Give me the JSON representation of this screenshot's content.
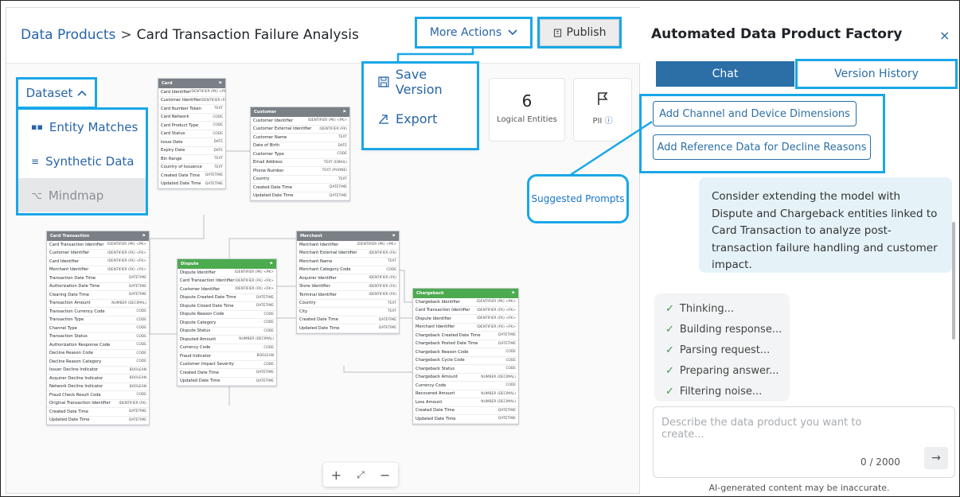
{
  "breadcrumb": {
    "parent": "Data Products",
    "separator": ">",
    "current": "Card Transaction Failure Analysis"
  },
  "toolbar": {
    "more_actions": "More Actions",
    "publish": "Publish"
  },
  "actions_menu": [
    {
      "label": "Save Version",
      "icon": "save-icon"
    },
    {
      "label": "Export",
      "icon": "export-icon"
    }
  ],
  "dataset": {
    "label": "Dataset",
    "items": [
      {
        "label": "Entity Matches",
        "icon": "grid-icon",
        "enabled": true
      },
      {
        "label": "Synthetic Data",
        "icon": "list-icon",
        "enabled": true
      },
      {
        "label": "Mindmap",
        "icon": "mindmap-icon",
        "enabled": false
      }
    ]
  },
  "stats": {
    "entities_count": "6",
    "entities_label": "Logical Entities",
    "pii_label": "PII"
  },
  "entities": {
    "card": {
      "name": "Card",
      "rows": [
        [
          "Card Identifier",
          "IDENTIFIER (PK) <PK>"
        ],
        [
          "Customer Identifier",
          "IDENTIFIER (FK) <FK>"
        ],
        [
          "Card Number Token",
          "TEXT"
        ],
        [
          "Card Network",
          "CODE"
        ],
        [
          "Card Product Type",
          "CODE"
        ],
        [
          "Card Status",
          "CODE"
        ],
        [
          "Issue Date",
          "DATE"
        ],
        [
          "Expiry Date",
          "DATE"
        ],
        [
          "Bin Range",
          "TEXT"
        ],
        [
          "Country of Issuance",
          "TEXT"
        ],
        [
          "Created Date Time",
          "DATETIME"
        ],
        [
          "Updated Date Time",
          "DATETIME"
        ]
      ]
    },
    "customer": {
      "name": "Customer",
      "rows": [
        [
          "Customer Identifier",
          "IDENTIFIER (PK) <PK>"
        ],
        [
          "Customer External Identifier",
          "IDENTIFIER (FK)"
        ],
        [
          "Customer Name",
          "TEXT"
        ],
        [
          "Date of Birth",
          "DATE"
        ],
        [
          "Customer Type",
          "CODE"
        ],
        [
          "Email Address",
          "TEXT (EMAIL)"
        ],
        [
          "Phone Number",
          "TEXT (PHONE)"
        ],
        [
          "Country",
          "TEXT"
        ],
        [
          "Created Date Time",
          "DATETIME"
        ],
        [
          "Updated Date Time",
          "DATETIME"
        ]
      ]
    },
    "card_transaction": {
      "name": "Card Transaction",
      "rows": [
        [
          "Card Transaction Identifier",
          "IDENTIFIER (PK) <PK>"
        ],
        [
          "Customer Identifier",
          "IDENTIFIER (FK) <FK>"
        ],
        [
          "Card Identifier",
          "IDENTIFIER (FK) <FK>"
        ],
        [
          "Merchant Identifier",
          "IDENTIFIER (FK) <FK>"
        ],
        [
          "Transaction Date Time",
          "DATETIME"
        ],
        [
          "Authorization Date Time",
          "DATETIME"
        ],
        [
          "Clearing Date Time",
          "DATETIME"
        ],
        [
          "Transaction Amount",
          "NUMBER (DECIMAL)"
        ],
        [
          "Transaction Currency Code",
          "CODE"
        ],
        [
          "Transaction Type",
          "CODE"
        ],
        [
          "Channel Type",
          "CODE"
        ],
        [
          "Transaction Status",
          "CODE"
        ],
        [
          "Authorization Response Code",
          "CODE"
        ],
        [
          "Decline Reason Code",
          "CODE"
        ],
        [
          "Decline Reason Category",
          "CODE"
        ],
        [
          "Issuer Decline Indicator",
          "BOOLEAN"
        ],
        [
          "Acquirer Decline Indicator",
          "BOOLEAN"
        ],
        [
          "Network Decline Indicator",
          "BOOLEAN"
        ],
        [
          "Fraud Check Result Code",
          "CODE"
        ],
        [
          "Original Transaction Identifier",
          "IDENTIFIER (FK)"
        ],
        [
          "Created Date Time",
          "DATETIME"
        ],
        [
          "Updated Date Time",
          "DATETIME"
        ]
      ]
    },
    "dispute": {
      "name": "Dispute",
      "rows": [
        [
          "Dispute Identifier",
          "IDENTIFIER (PK) <PK>"
        ],
        [
          "Card Transaction Identifier",
          "IDENTIFIER (FK) <FK>"
        ],
        [
          "Customer Identifier",
          "IDENTIFIER (FK) <FK>"
        ],
        [
          "Dispute Created Date Time",
          "DATETIME"
        ],
        [
          "Dispute Closed Date Time",
          "DATETIME"
        ],
        [
          "Dispute Reason Code",
          "CODE"
        ],
        [
          "Dispute Category",
          "CODE"
        ],
        [
          "Dispute Status",
          "CODE"
        ],
        [
          "Disputed Amount",
          "NUMBER (DECIMAL)"
        ],
        [
          "Currency Code",
          "CODE"
        ],
        [
          "Fraud Indicator",
          "BOOLEAN"
        ],
        [
          "Customer Impact Severity",
          "CODE"
        ],
        [
          "Created Date Time",
          "DATETIME"
        ],
        [
          "Updated Date Time",
          "DATETIME"
        ]
      ]
    },
    "merchant": {
      "name": "Merchant",
      "rows": [
        [
          "Merchant Identifier",
          "IDENTIFIER (PK) <PK>"
        ],
        [
          "Merchant External Identifier",
          "IDENTIFIER (FK)"
        ],
        [
          "Merchant Name",
          "TEXT"
        ],
        [
          "Merchant Category Code",
          "CODE"
        ],
        [
          "Acquirer Identifier",
          "IDENTIFIER (FK)"
        ],
        [
          "Store Identifier",
          "IDENTIFIER (FK)"
        ],
        [
          "Terminal Identifier",
          "IDENTIFIER (FK)"
        ],
        [
          "Country",
          "TEXT"
        ],
        [
          "City",
          "TEXT"
        ],
        [
          "Created Date Time",
          "DATETIME"
        ],
        [
          "Updated Date Time",
          "DATETIME"
        ]
      ]
    },
    "chargeback": {
      "name": "Chargeback",
      "rows": [
        [
          "Chargeback Identifier",
          "IDENTIFIER (PK) <PK>"
        ],
        [
          "Card Transaction Identifier",
          "IDENTIFIER (FK) <FK>"
        ],
        [
          "Dispute Identifier",
          "IDENTIFIER (FK) <FK>"
        ],
        [
          "Merchant Identifier",
          "IDENTIFIER (FK) <FK>"
        ],
        [
          "Chargeback Created Date Time",
          "DATETIME"
        ],
        [
          "Chargeback Posted Date Time",
          "DATETIME"
        ],
        [
          "Chargeback Reason Code",
          "CODE"
        ],
        [
          "Chargeback Cycle Code",
          "CODE"
        ],
        [
          "Chargeback Status",
          "CODE"
        ],
        [
          "Chargeback Amount",
          "NUMBER (DECIMAL)"
        ],
        [
          "Currency Code",
          "CODE"
        ],
        [
          "Recovered Amount",
          "NUMBER (DECIMAL)"
        ],
        [
          "Loss Amount",
          "NUMBER (DECIMAL)"
        ],
        [
          "Created Date Time",
          "DATETIME"
        ],
        [
          "Updated Date Time",
          "DATETIME"
        ]
      ]
    }
  },
  "zoom": {
    "plus": "+",
    "fit": "⤢",
    "minus": "−"
  },
  "panel": {
    "title": "Automated Data Product Factory",
    "close": "×",
    "tabs": [
      {
        "label": "Chat",
        "active": true
      },
      {
        "label": "Version History",
        "active": false
      }
    ],
    "suggestions": [
      "Add Channel and Device Dimensions",
      "Add Reference Data for Decline Reasons"
    ],
    "callout": "Suggested Prompts",
    "message": "Consider extending the model with Dispute and Chargeback entities linked to Card Transaction to analyze post-transaction failure handling and customer impact.",
    "status_steps": [
      "Thinking...",
      "Building response...",
      "Parsing request...",
      "Preparing answer...",
      "Filtering noise..."
    ],
    "input_placeholder": "Describe the data product you want to create...",
    "counter": "0 / 2000",
    "send_icon": "arrow-right-icon",
    "disclaimer": "AI-generated content may be inaccurate."
  },
  "colors": {
    "accent": "#2b6fa6",
    "link": "#2764a8",
    "highlight": "#19a7e8",
    "entity_gray": "#7b8087",
    "entity_green": "#4caa4f",
    "bubble": "#e5f3f8"
  }
}
